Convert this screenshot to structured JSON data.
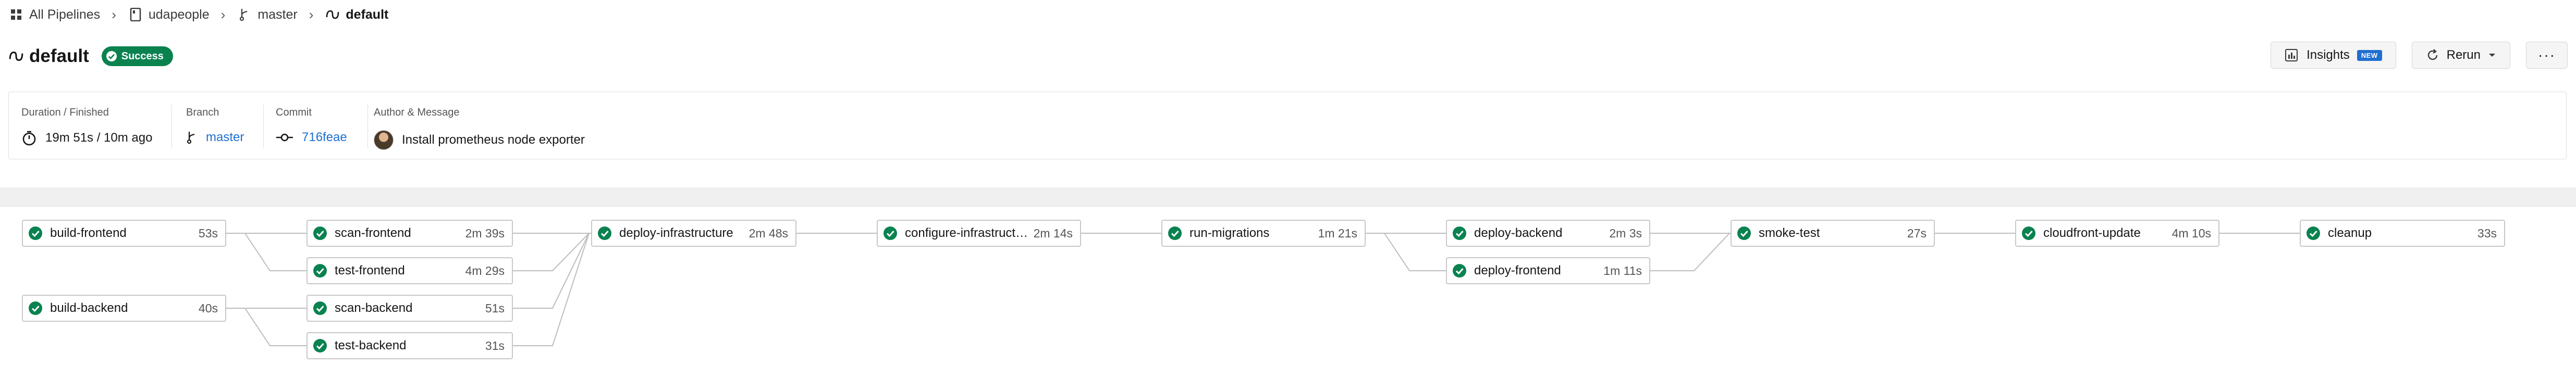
{
  "breadcrumb": {
    "all_pipelines": "All Pipelines",
    "project": "udapeople",
    "branch": "master",
    "workflow": "default"
  },
  "header": {
    "title": "default",
    "status": "Success",
    "status_color": "#0a8250",
    "insights_label": "Insights",
    "insights_badge": "NEW",
    "rerun_label": "Rerun",
    "more_label": "···"
  },
  "summary": {
    "duration_label": "Duration / Finished",
    "duration_value": "19m 51s / 10m ago",
    "branch_label": "Branch",
    "branch_value": "master",
    "commit_label": "Commit",
    "commit_value": "716feae",
    "author_label": "Author & Message",
    "message": "Install prometheus node exporter"
  },
  "accent_color": "#1f6fd1",
  "jobs": [
    {
      "name": "build-frontend",
      "time": "53s",
      "status": "success"
    },
    {
      "name": "build-backend",
      "time": "40s",
      "status": "success"
    },
    {
      "name": "scan-frontend",
      "time": "2m 39s",
      "status": "success"
    },
    {
      "name": "test-frontend",
      "time": "4m 29s",
      "status": "success"
    },
    {
      "name": "scan-backend",
      "time": "51s",
      "status": "success"
    },
    {
      "name": "test-backend",
      "time": "31s",
      "status": "success"
    },
    {
      "name": "deploy-infrastructure",
      "time": "2m 48s",
      "status": "success"
    },
    {
      "name": "configure-infrastructure",
      "time": "2m 14s",
      "status": "success"
    },
    {
      "name": "run-migrations",
      "time": "1m 21s",
      "status": "success"
    },
    {
      "name": "deploy-backend",
      "time": "2m 3s",
      "status": "success"
    },
    {
      "name": "deploy-frontend",
      "time": "1m 11s",
      "status": "success"
    },
    {
      "name": "smoke-test",
      "time": "27s",
      "status": "success"
    },
    {
      "name": "cloudfront-update",
      "time": "4m 10s",
      "status": "success"
    },
    {
      "name": "cleanup",
      "time": "33s",
      "status": "success"
    }
  ]
}
